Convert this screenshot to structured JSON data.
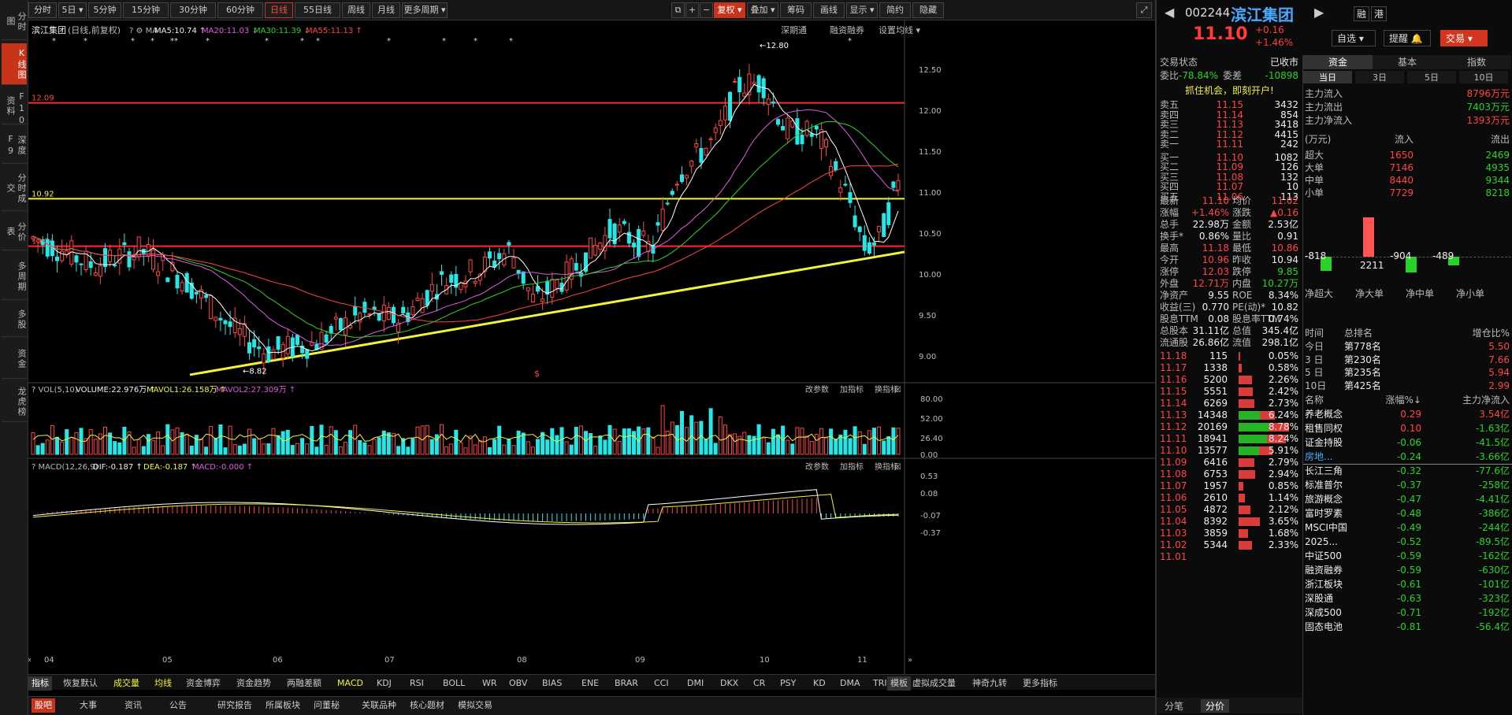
{
  "vtabs": [
    "分时图",
    "K线图",
    "F10资料",
    "深度F9",
    "分时成交",
    "分价表",
    "多周期",
    "多股",
    "资金",
    "龙虎榜"
  ],
  "toolbar": {
    "periods": [
      "分时",
      "5日",
      "5分钟",
      "15分钟",
      "30分钟",
      "60分钟",
      "日线",
      "55日线",
      "周线",
      "月线",
      "更多周期"
    ],
    "active": "日线",
    "right_items": [
      "复权",
      "叠加",
      "筹码",
      "画线",
      "显示",
      "简约",
      "隐藏"
    ]
  },
  "legend": {
    "stock": "滨江集团",
    "mode": "(日线,前复权)",
    "ma5": "MA5:10.74",
    "ma20": "MA20:11.03",
    "ma30": "MA30:11.39",
    "ma55": "MA55:11.13",
    "right": [
      "深期通",
      "融资融券",
      "设置均线"
    ]
  },
  "price_axis": [
    "12.50",
    "12.00",
    "11.50",
    "11.00",
    "10.50",
    "10.00",
    "9.50",
    "9.00"
  ],
  "level_labels": {
    "top_red": "12.09",
    "yellow": "10.92",
    "mid_red": "10.34",
    "high": "12.80",
    "low": "8.82"
  },
  "vol": {
    "title": "VOL(5,10)",
    "volume": "VOLUME:22.976万",
    "mavol1": "MAVOL1:26.158万",
    "mavol2": "MAVOL2:27.309万",
    "axis": [
      "80.00",
      "52.00",
      "26.40",
      "0.00"
    ],
    "btns": [
      "改参数",
      "加指标",
      "换指标"
    ]
  },
  "macd": {
    "title": "MACD(12,26,9)",
    "dif": "DIF:-0.187",
    "dea": "DEA:-0.187",
    "macd": "MACD:-0.000",
    "axis": [
      "0.53",
      "0.08",
      "-0.07",
      "-0.37"
    ],
    "btns": [
      "改参数",
      "加指标",
      "换指标"
    ]
  },
  "months": [
    "04",
    "05",
    "06",
    "07",
    "08",
    "09",
    "10",
    "11"
  ],
  "indicators": [
    "指标",
    "恢复默认",
    "成交量",
    "均线",
    "资金博弈",
    "资金趋势",
    "两融差额",
    "MACD",
    "KDJ",
    "RSI",
    "BOLL",
    "WR",
    "OBV",
    "BIAS",
    "ENE",
    "BRAR",
    "CCI",
    "DMI",
    "DKX",
    "CR",
    "PSY",
    "KD",
    "DMA",
    "TRIX",
    "虚拟成交量",
    "神奇九转",
    "更多指标",
    "模板"
  ],
  "btabs": [
    "股吧",
    "大事",
    "资讯",
    "公告",
    "研究报告",
    "所属板块",
    "问董秘",
    "关联品种",
    "核心题材",
    "模拟交易"
  ],
  "quote": {
    "code": "002244",
    "name": "滨江集团",
    "price": "11.10",
    "chg": "+0.16",
    "pct": "+1.46%",
    "btns": [
      "融",
      "港",
      "自选",
      "提醒",
      "交易"
    ],
    "status_label": "交易状态",
    "status": "已收市",
    "wb": "委比",
    "wb_v": "-78.84%",
    "wc": "委差",
    "wc_v": "-10898",
    "ad": "抓住机会，即刻开户!",
    "asks": [
      [
        "卖五",
        "11.15",
        "3432"
      ],
      [
        "卖四",
        "11.14",
        "854"
      ],
      [
        "卖三",
        "11.13",
        "3418"
      ],
      [
        "卖二",
        "11.12",
        "4415"
      ],
      [
        "卖一",
        "11.11",
        "242"
      ]
    ],
    "bids": [
      [
        "买一",
        "11.10",
        "1082"
      ],
      [
        "买二",
        "11.09",
        "126"
      ],
      [
        "买三",
        "11.08",
        "132"
      ],
      [
        "买四",
        "11.07",
        "10"
      ],
      [
        "买五",
        "11.06",
        "113"
      ]
    ],
    "stats": [
      [
        "最新",
        "11.10",
        "均价",
        "11.02"
      ],
      [
        "涨幅",
        "+1.46%",
        "涨跌",
        "▲0.16"
      ],
      [
        "总手",
        "22.98万",
        "金额",
        "2.53亿"
      ],
      [
        "换手*",
        "0.86%",
        "量比",
        "0.91"
      ],
      [
        "最高",
        "11.18",
        "最低",
        "10.86"
      ],
      [
        "今开",
        "10.96",
        "昨收",
        "10.94"
      ],
      [
        "涨停",
        "12.03",
        "跌停",
        "9.85"
      ],
      [
        "外盘",
        "12.71万",
        "内盘",
        "10.27万"
      ],
      [
        "净资产",
        "9.55",
        "ROE",
        "8.34%"
      ],
      [
        "收益(三)",
        "0.770",
        "PE(动)*",
        "10.82"
      ],
      [
        "股息TTM",
        "0.08",
        "股息率TTM",
        "0.74%"
      ],
      [
        "总股本",
        "31.11亿",
        "总值",
        "345.4亿"
      ],
      [
        "流通股",
        "26.86亿",
        "流值",
        "298.1亿"
      ]
    ],
    "dist": [
      [
        "11.18",
        "115",
        "0.05%"
      ],
      [
        "11.17",
        "1338",
        "0.58%"
      ],
      [
        "11.16",
        "5200",
        "2.26%"
      ],
      [
        "11.15",
        "5551",
        "2.42%"
      ],
      [
        "11.14",
        "6269",
        "2.73%"
      ],
      [
        "11.13",
        "14348",
        "6.24%"
      ],
      [
        "11.12",
        "20169",
        "8.78%"
      ],
      [
        "11.11",
        "18941",
        "8.24%"
      ],
      [
        "11.10",
        "13577",
        "5.91%"
      ],
      [
        "11.09",
        "6416",
        "2.79%"
      ],
      [
        "11.08",
        "6753",
        "2.94%"
      ],
      [
        "11.07",
        "1957",
        "0.85%"
      ],
      [
        "11.06",
        "2610",
        "1.14%"
      ],
      [
        "11.05",
        "4872",
        "2.12%"
      ],
      [
        "11.04",
        "8392",
        "3.65%"
      ],
      [
        "11.03",
        "3859",
        "1.68%"
      ],
      [
        "11.02",
        "5344",
        "2.33%"
      ],
      [
        "11.01",
        "",
        ""
      ]
    ],
    "dist_tabs": [
      "分笔",
      "分价"
    ]
  },
  "fund": {
    "tabs": [
      "资金",
      "基本",
      "指数"
    ],
    "sub": [
      "当日",
      "3日",
      "5日",
      "10日"
    ],
    "flows": [
      [
        "主力流入",
        "8796万元"
      ],
      [
        "主力流出",
        "7403万元"
      ],
      [
        "主力净流入",
        "1393万元"
      ]
    ],
    "unit": "(万元)",
    "in": "流入",
    "out": "流出",
    "types": [
      [
        "超大",
        "1650",
        "2469"
      ],
      [
        "大单",
        "7146",
        "4935"
      ],
      [
        "中单",
        "8440",
        "9344"
      ],
      [
        "小单",
        "7729",
        "8218"
      ]
    ],
    "bars": [
      "-818",
      "2211",
      "-904",
      "-489"
    ],
    "bar_labels": [
      "净超大",
      "净大单",
      "净中单",
      "净小单"
    ],
    "rank_head": [
      "时间",
      "总排名",
      "增仓比%"
    ],
    "ranks": [
      [
        "今日",
        "第778名",
        "5.50"
      ],
      [
        "3 日",
        "第230名",
        "7.66"
      ],
      [
        "5 日",
        "第235名",
        "5.94"
      ],
      [
        "10日",
        "第425名",
        "2.99"
      ]
    ],
    "sect_head": [
      "名称",
      "涨幅%↓",
      "主力净流入"
    ],
    "sectors": [
      [
        "养老概念",
        "0.29",
        "3.54亿"
      ],
      [
        "租售同权",
        "0.10",
        "-1.63亿"
      ],
      [
        "证金持股",
        "-0.06",
        "-41.5亿"
      ],
      [
        "房地...",
        "-0.24",
        "-3.66亿"
      ],
      [
        "长江三角",
        "-0.32",
        "-77.6亿"
      ],
      [
        "标准普尔",
        "-0.37",
        "-258亿"
      ],
      [
        "旅游概念",
        "-0.47",
        "-4.41亿"
      ],
      [
        "富时罗素",
        "-0.48",
        "-386亿"
      ],
      [
        "MSCI中国",
        "-0.49",
        "-244亿"
      ],
      [
        "2025...",
        "-0.52",
        "-89.5亿"
      ],
      [
        "中证500",
        "-0.59",
        "-162亿"
      ],
      [
        "融资融券",
        "-0.59",
        "-630亿"
      ],
      [
        "浙江板块",
        "-0.61",
        "-101亿"
      ],
      [
        "深股通",
        "-0.63",
        "-323亿"
      ],
      [
        "深成500",
        "-0.71",
        "-192亿"
      ],
      [
        "固态电池",
        "-0.81",
        "-56.4亿"
      ]
    ]
  }
}
